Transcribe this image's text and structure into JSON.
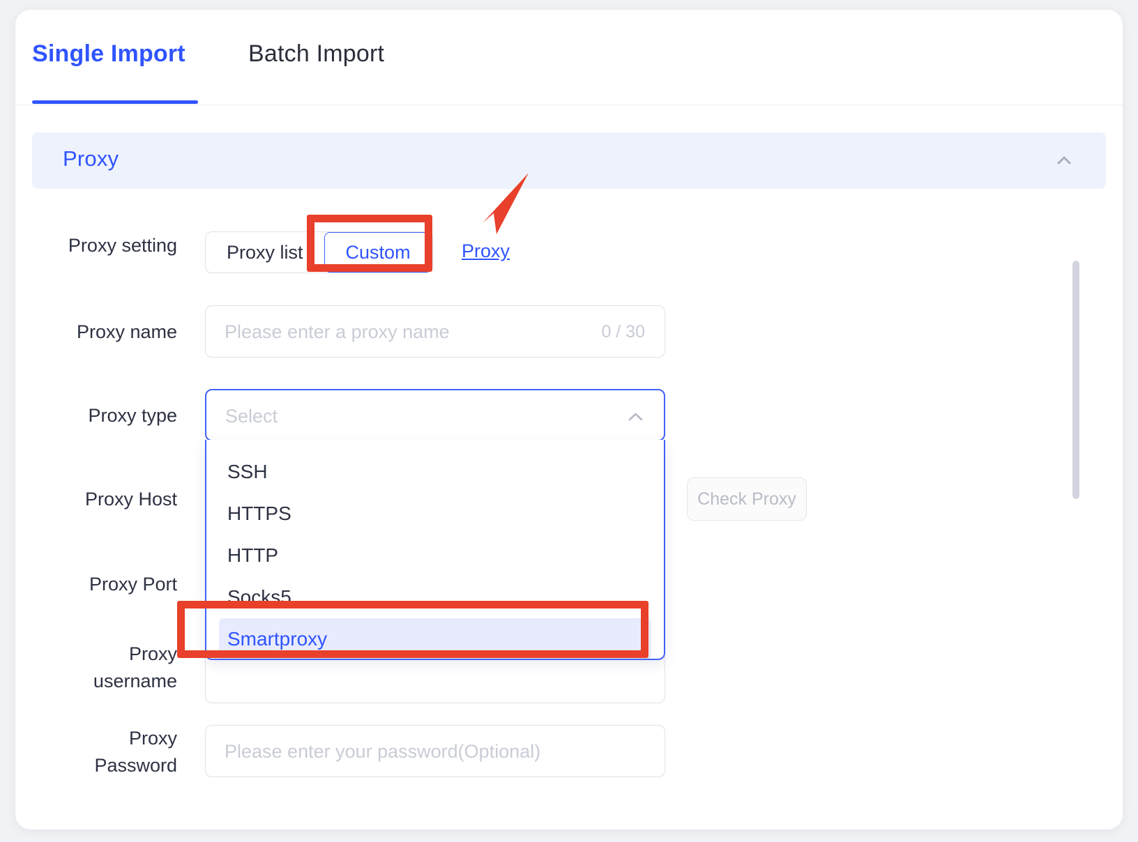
{
  "tabs": [
    {
      "id": "single",
      "label": "Single Import",
      "active": true
    },
    {
      "id": "batch",
      "label": "Batch Import",
      "active": false
    }
  ],
  "section": {
    "title": "Proxy",
    "collapse_icon": "chevron-up-icon"
  },
  "form": {
    "proxy_setting": {
      "label": "Proxy setting",
      "options": [
        "Proxy list",
        "Custom"
      ],
      "selected": "Custom",
      "link_label": "Proxy"
    },
    "proxy_name": {
      "label": "Proxy name",
      "value": "",
      "placeholder": "Please enter a proxy name",
      "counter": "0 / 30"
    },
    "proxy_type": {
      "label": "Proxy type",
      "value": "",
      "placeholder": "Select",
      "chevron_icon": "chevron-up-icon",
      "options": [
        "SSH",
        "HTTPS",
        "HTTP",
        "Socks5",
        "Smartproxy"
      ],
      "highlighted_option": "Smartproxy"
    },
    "proxy_host": {
      "label": "Proxy Host",
      "value": "",
      "placeholder": ""
    },
    "proxy_port": {
      "label": "Proxy Port",
      "value": "",
      "placeholder": ""
    },
    "proxy_username": {
      "label_line1": "Proxy",
      "label_line2": "username",
      "value": "",
      "placeholder": ""
    },
    "proxy_password": {
      "label_line1": "Proxy",
      "label_line2": "Password",
      "value": "",
      "placeholder": "Please enter your password(Optional)"
    },
    "check_proxy_button": "Check Proxy"
  },
  "colors": {
    "accent": "#2f54ff",
    "annotation": "#e8402a",
    "section_bg": "#eef2fd",
    "highlight_bg": "#e8ebfd"
  }
}
